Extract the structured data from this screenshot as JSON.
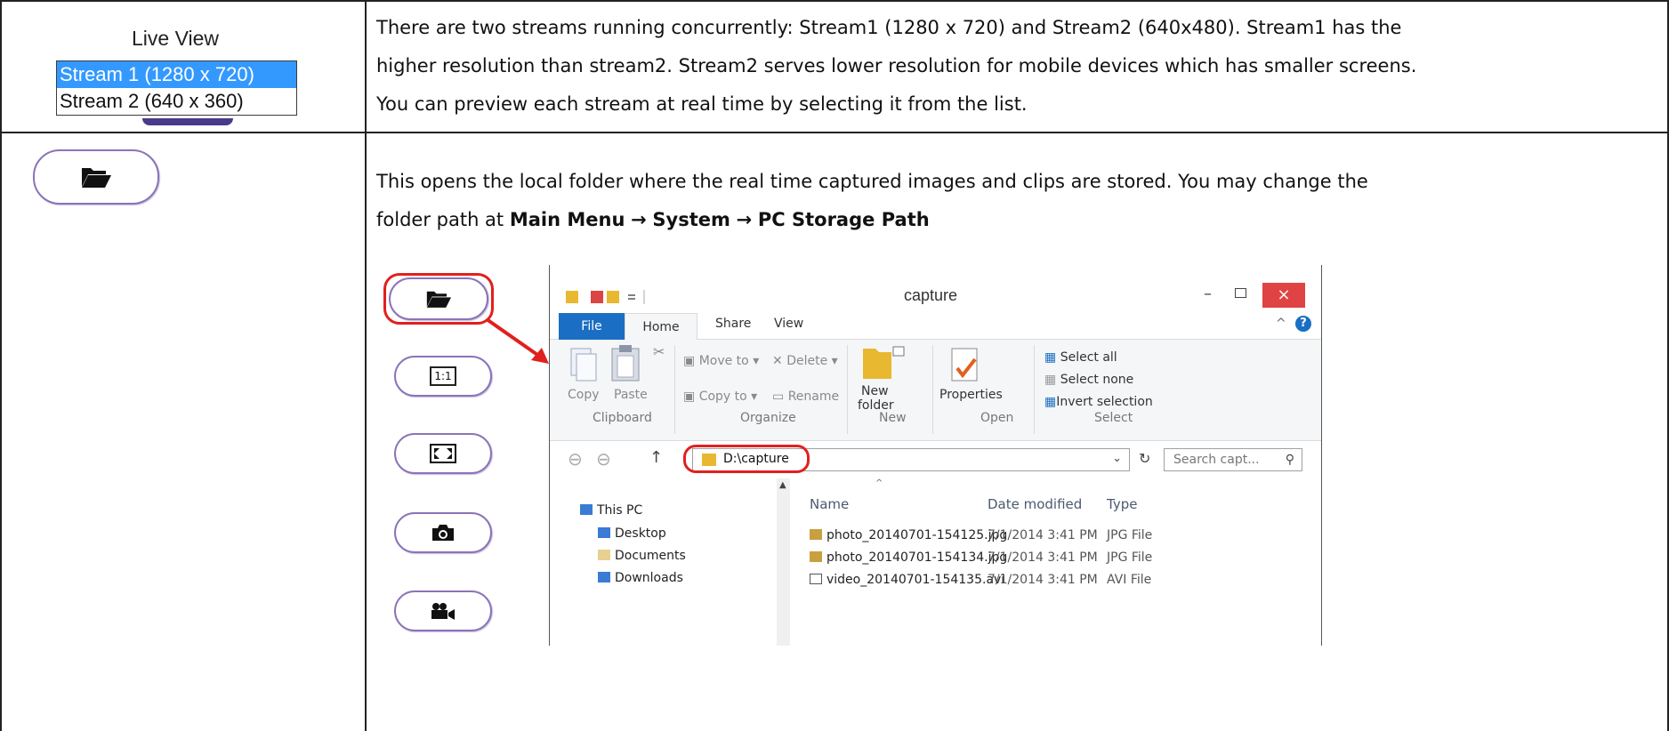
{
  "row1": {
    "live_view_title": "Live View",
    "streams": [
      {
        "label": "Stream 1 (1280 x 720)",
        "selected": true
      },
      {
        "label": "Stream 2 (640 x 360)",
        "selected": false
      }
    ],
    "desc_lines": [
      "There are two streams running concurrently: Stream1 (1280 x 720) and Stream2 (640x480). Stream1 has the",
      "higher resolution than stream2. Stream2 serves lower resolution for mobile devices which has smaller screens.",
      "You can preview each stream at real time by selecting it from the list."
    ]
  },
  "row2": {
    "button_icon": "folder-open-icon",
    "desc_line1": "This opens the local folder where the real time captured images and clips are stored. You may change the",
    "desc_line2_prefix": "folder path at ",
    "path": [
      "Main Menu",
      "System",
      "PC Storage Path"
    ],
    "arrow": "→"
  },
  "screenshot": {
    "side_buttons": [
      "folder-open-icon",
      "actual-size-icon",
      "fullscreen-icon",
      "camera-icon",
      "video-record-icon"
    ],
    "actual_size_label": "1:1",
    "window_title": "capture",
    "controls": {
      "minimize": "–",
      "close": "×"
    },
    "tabs": [
      "File",
      "Home",
      "Share",
      "View"
    ],
    "ribbon": {
      "clipboard": {
        "copy": "Copy",
        "paste": "Paste",
        "group": "Clipboard"
      },
      "organize": {
        "move_to": "Move to",
        "copy_to": "Copy to",
        "delete": "Delete",
        "rename": "Rename",
        "group": "Organize"
      },
      "new": {
        "new_folder_1": "New",
        "new_folder_2": "folder",
        "group": "New"
      },
      "open": {
        "properties": "Properties",
        "group": "Open"
      },
      "select": {
        "select_all": "Select all",
        "select_none": "Select none",
        "invert": "Invert selection",
        "group": "Select"
      }
    },
    "address": "D:\\capture",
    "search_placeholder": "Search capt...",
    "nav": [
      "This PC",
      "Desktop",
      "Documents",
      "Downloads"
    ],
    "columns": [
      "Name",
      "Date modified",
      "Type"
    ],
    "files": [
      {
        "name": "photo_20140701-154125.jpg",
        "date": "7/1/2014 3:41 PM",
        "type": "JPG File"
      },
      {
        "name": "photo_20140701-154134.jpg",
        "date": "7/1/2014 3:41 PM",
        "type": "JPG File"
      },
      {
        "name": "video_20140701-154135.avi",
        "date": "7/1/2014 3:41 PM",
        "type": "AVI File"
      }
    ],
    "colors": {
      "file_tab": "#1a6fc4",
      "close": "#e04343",
      "highlight": "#e0201e",
      "button_border": "#8a74b8"
    }
  }
}
